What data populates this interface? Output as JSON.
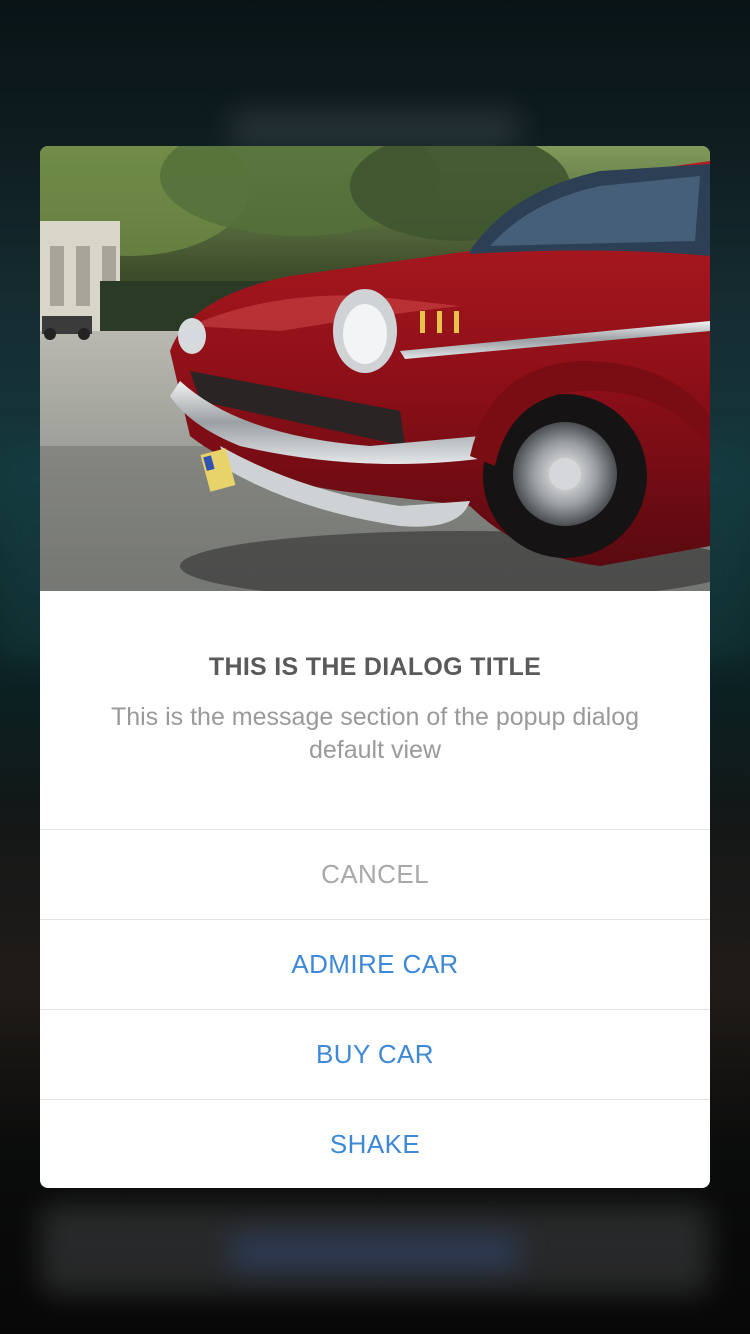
{
  "dialog": {
    "title": "THIS IS THE DIALOG TITLE",
    "message": "This is the message section of the popup dialog default view",
    "hero_image": "red-classic-car-photo",
    "actions": [
      {
        "label": "CANCEL",
        "style": "cancel",
        "color": "#a8a8a8"
      },
      {
        "label": "ADMIRE CAR",
        "style": "primary",
        "color": "#3e88d8"
      },
      {
        "label": "BUY CAR",
        "style": "primary",
        "color": "#3e88d8"
      },
      {
        "label": "SHAKE",
        "style": "primary",
        "color": "#3e88d8"
      }
    ]
  },
  "colors": {
    "accent": "#3e88d8",
    "title": "#5a5a5a",
    "message": "#9a9a9a",
    "divider": "#e2e2e2"
  }
}
